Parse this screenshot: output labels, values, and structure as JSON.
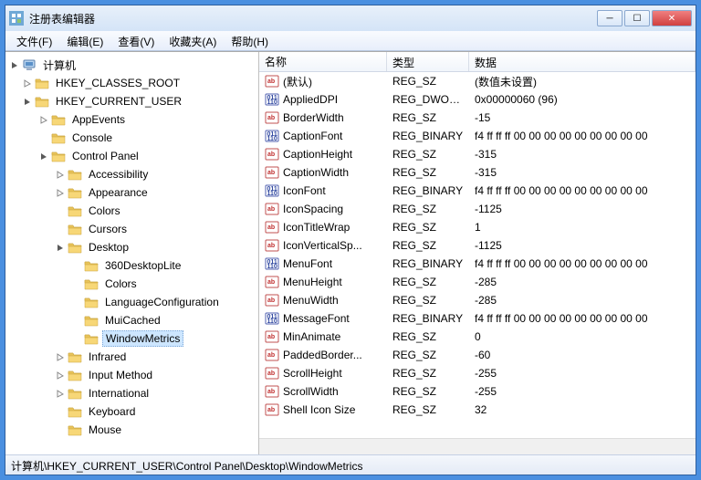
{
  "window": {
    "title": "注册表编辑器"
  },
  "menu": {
    "file": "文件(F)",
    "edit": "编辑(E)",
    "view": "查看(V)",
    "fav": "收藏夹(A)",
    "help": "帮助(H)"
  },
  "tree": {
    "root": "计算机",
    "hkcr": "HKEY_CLASSES_ROOT",
    "hkcu": "HKEY_CURRENT_USER",
    "appevents": "AppEvents",
    "console": "Console",
    "cp": "Control Panel",
    "access": "Accessibility",
    "appear": "Appearance",
    "colors": "Colors",
    "cursors": "Cursors",
    "desktop": "Desktop",
    "d360": "360DesktopLite",
    "dcolors": "Colors",
    "langcfg": "LanguageConfiguration",
    "muicached": "MuiCached",
    "winmetrics": "WindowMetrics",
    "infrared": "Infrared",
    "inputm": "Input Method",
    "intl": "International",
    "keyboard": "Keyboard",
    "mouse": "Mouse"
  },
  "cols": {
    "name": "名称",
    "type": "类型",
    "data": "数据"
  },
  "values": [
    {
      "name": "(默认)",
      "type": "REG_SZ",
      "data": "(数值未设置)",
      "kind": "str"
    },
    {
      "name": "AppliedDPI",
      "type": "REG_DWORD",
      "data": "0x00000060 (96)",
      "kind": "bin"
    },
    {
      "name": "BorderWidth",
      "type": "REG_SZ",
      "data": "-15",
      "kind": "str"
    },
    {
      "name": "CaptionFont",
      "type": "REG_BINARY",
      "data": "f4 ff ff ff 00 00 00 00 00 00 00 00 00",
      "kind": "bin"
    },
    {
      "name": "CaptionHeight",
      "type": "REG_SZ",
      "data": "-315",
      "kind": "str"
    },
    {
      "name": "CaptionWidth",
      "type": "REG_SZ",
      "data": "-315",
      "kind": "str"
    },
    {
      "name": "IconFont",
      "type": "REG_BINARY",
      "data": "f4 ff ff ff 00 00 00 00 00 00 00 00 00",
      "kind": "bin"
    },
    {
      "name": "IconSpacing",
      "type": "REG_SZ",
      "data": "-1125",
      "kind": "str"
    },
    {
      "name": "IconTitleWrap",
      "type": "REG_SZ",
      "data": "1",
      "kind": "str"
    },
    {
      "name": "IconVerticalSp...",
      "type": "REG_SZ",
      "data": "-1125",
      "kind": "str"
    },
    {
      "name": "MenuFont",
      "type": "REG_BINARY",
      "data": "f4 ff ff ff 00 00 00 00 00 00 00 00 00",
      "kind": "bin"
    },
    {
      "name": "MenuHeight",
      "type": "REG_SZ",
      "data": "-285",
      "kind": "str"
    },
    {
      "name": "MenuWidth",
      "type": "REG_SZ",
      "data": "-285",
      "kind": "str"
    },
    {
      "name": "MessageFont",
      "type": "REG_BINARY",
      "data": "f4 ff ff ff 00 00 00 00 00 00 00 00 00",
      "kind": "bin"
    },
    {
      "name": "MinAnimate",
      "type": "REG_SZ",
      "data": "0",
      "kind": "str"
    },
    {
      "name": "PaddedBorder...",
      "type": "REG_SZ",
      "data": "-60",
      "kind": "str"
    },
    {
      "name": "ScrollHeight",
      "type": "REG_SZ",
      "data": "-255",
      "kind": "str"
    },
    {
      "name": "ScrollWidth",
      "type": "REG_SZ",
      "data": "-255",
      "kind": "str"
    },
    {
      "name": "Shell Icon Size",
      "type": "REG_SZ",
      "data": "32",
      "kind": "str"
    }
  ],
  "status": {
    "path": "计算机\\HKEY_CURRENT_USER\\Control Panel\\Desktop\\WindowMetrics"
  }
}
